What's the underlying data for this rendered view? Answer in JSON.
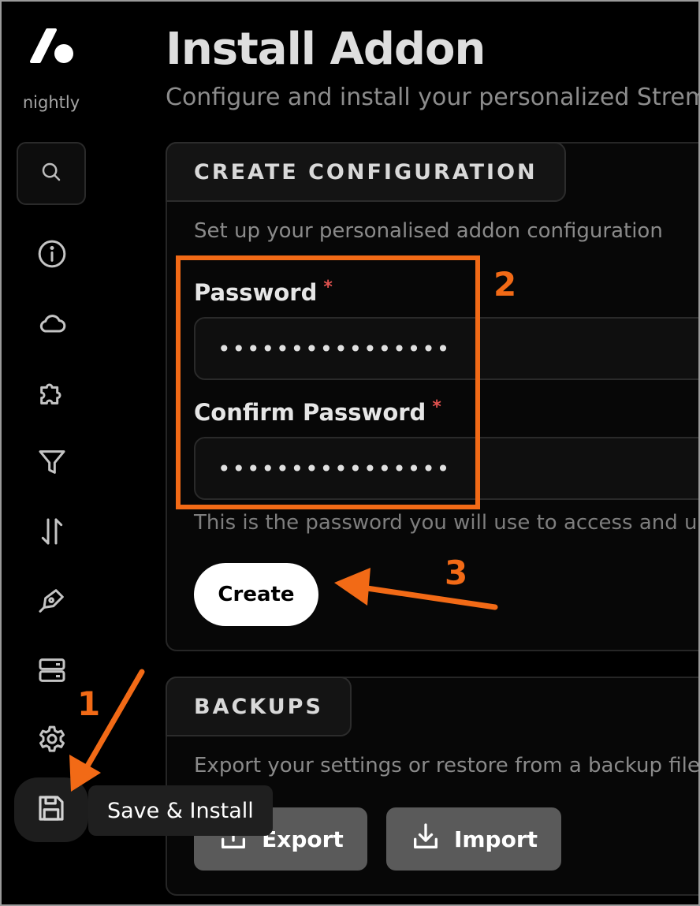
{
  "sidebar": {
    "brand": "nightly",
    "icons": [
      "search-icon",
      "info-icon",
      "cloud-icon",
      "puzzle-icon",
      "filter-icon",
      "sort-icon",
      "pen-icon",
      "server-icon",
      "gear-icon",
      "save-icon"
    ],
    "tooltip": "Save & Install"
  },
  "header": {
    "title": "Install Addon",
    "subtitle": "Configure and install your personalized Stremio addon"
  },
  "create_config": {
    "tab_label": "CREATE CONFIGURATION",
    "description": "Set up your personalised addon configuration",
    "password_label": "Password",
    "password_value": "••••••••••••••••",
    "confirm_label": "Confirm Password",
    "confirm_value": "••••••••••••••••",
    "required_mark": "*",
    "hint": "This is the password you will use to access and update your configuration",
    "create_button": "Create"
  },
  "backups": {
    "tab_label": "BACKUPS",
    "description": "Export your settings or restore from a backup file",
    "export_button": "Export",
    "import_button": "Import"
  },
  "annotations": {
    "step1": "1",
    "step2": "2",
    "step3": "3",
    "color": "#f26a16"
  },
  "colors": {
    "background": "#000000",
    "accent_annotation": "#f26a16",
    "required": "#e0524f"
  }
}
